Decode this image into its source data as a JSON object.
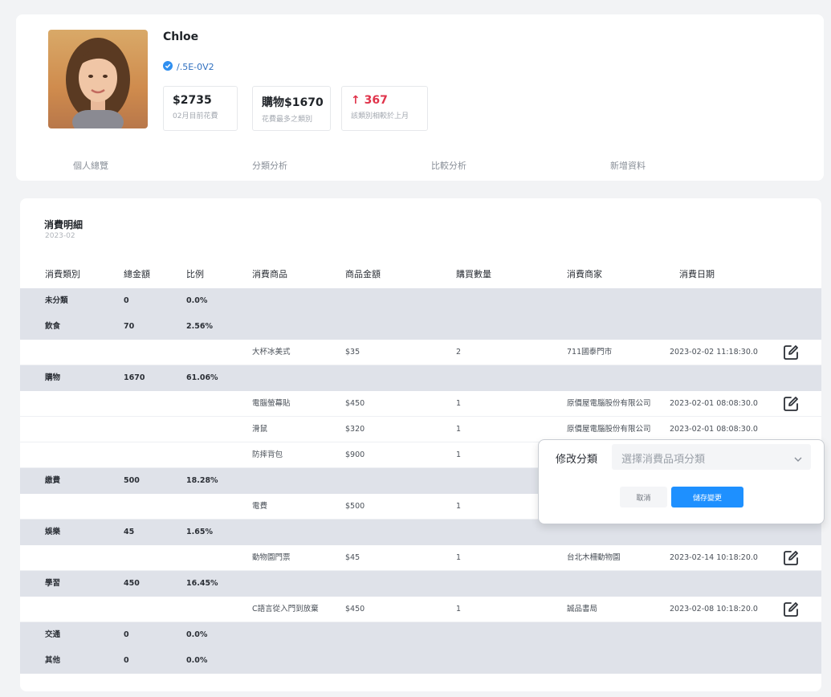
{
  "profile": {
    "name": "Chloe",
    "uid": "/.5E-0V2",
    "stats": [
      {
        "value": "$2735",
        "label": "02月目前花費"
      },
      {
        "value": "購物$1670",
        "label": "花費最多之類別"
      },
      {
        "value": "↑ 367",
        "label": "該類別相較於上月"
      }
    ],
    "tabs": [
      "個人總覽",
      "分類分析",
      "比較分析",
      "新增資料"
    ]
  },
  "detail": {
    "title": "消費明細",
    "subtitle": "2023-02",
    "headers": [
      "消費類別",
      "總金額",
      "比例",
      "消費商品",
      "商品金額",
      "購買數量",
      "消費商家",
      "消費日期"
    ],
    "rows": [
      {
        "category": "未分類",
        "total": "0",
        "ratio": "0.0%"
      },
      {
        "category": "飲食",
        "total": "70",
        "ratio": "2.56%"
      },
      {
        "product": "大杯冰美式",
        "price": "$35",
        "qty": "2",
        "merchant": "711國泰門市",
        "date": "2023-02-02 11:18:30.0"
      },
      {
        "category": "購物",
        "total": "1670",
        "ratio": "61.06%"
      },
      {
        "product": "電腦螢幕貼",
        "price": "$450",
        "qty": "1",
        "merchant": "原價屋電腦股份有限公司",
        "date": "2023-02-01 08:08:30.0"
      },
      {
        "product": "滑鼠",
        "price": "$320",
        "qty": "1",
        "merchant": "原價屋電腦股份有限公司",
        "date": "2023-02-01 08:08:30.0"
      },
      {
        "product": "防摔背包",
        "price": "$900",
        "qty": "1",
        "merchant": "",
        "date": ""
      },
      {
        "category": "繳費",
        "total": "500",
        "ratio": "18.28%"
      },
      {
        "product": "電費",
        "price": "$500",
        "qty": "1",
        "merchant": "",
        "date": ""
      },
      {
        "category": "娛樂",
        "total": "45",
        "ratio": "1.65%"
      },
      {
        "product": "動物園門票",
        "price": "$45",
        "qty": "1",
        "merchant": "台北木柵動物園",
        "date": "2023-02-14 10:18:20.0"
      },
      {
        "category": "學習",
        "total": "450",
        "ratio": "16.45%"
      },
      {
        "product": "C語言從入門到放棄",
        "price": "$450",
        "qty": "1",
        "merchant": "誠品書局",
        "date": "2023-02-08 10:18:20.0"
      },
      {
        "category": "交通",
        "total": "0",
        "ratio": "0.0%"
      },
      {
        "category": "其他",
        "total": "0",
        "ratio": "0.0%"
      }
    ]
  },
  "popup": {
    "label": "修改分類",
    "select_placeholder": "選擇消費品項分類",
    "cancel_label": "取消",
    "save_label": "儲存變更"
  },
  "colors": {
    "accent": "#1e90ff",
    "increase": "#e0344b",
    "verified": "#2f6fbf"
  }
}
